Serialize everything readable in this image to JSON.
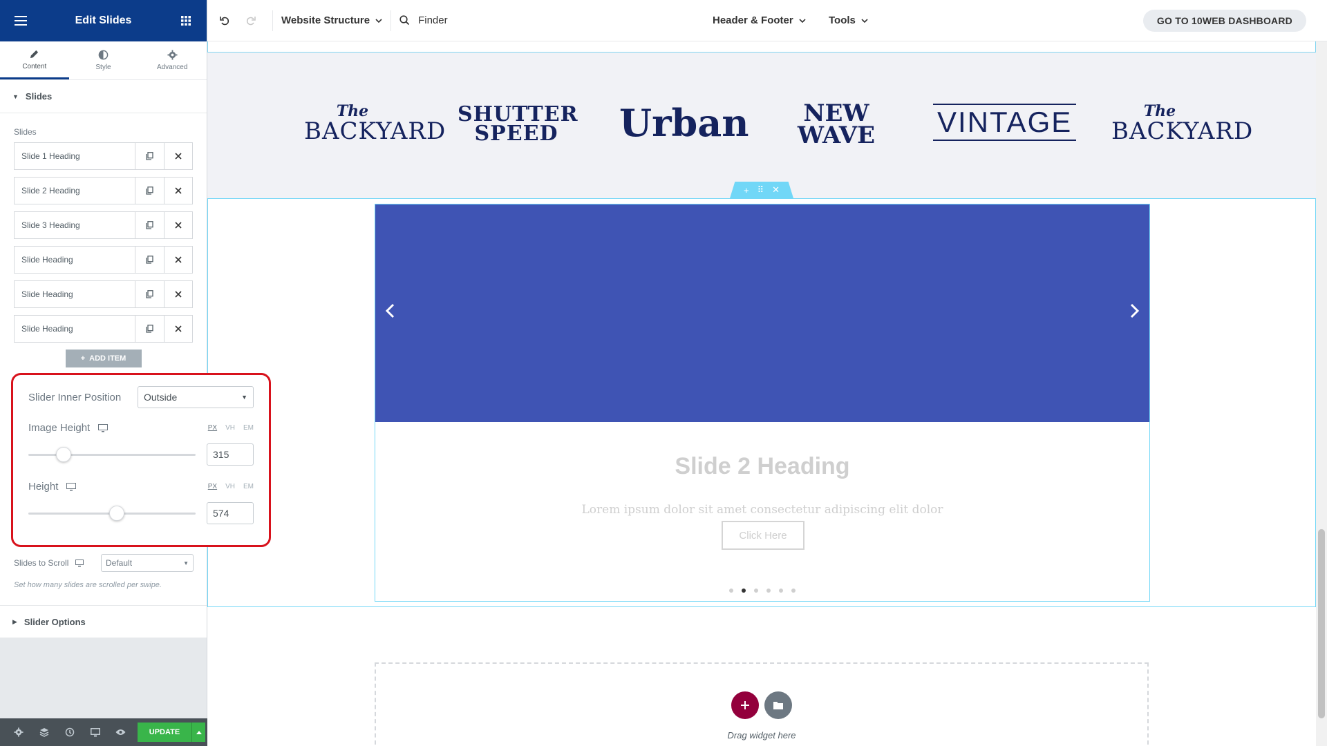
{
  "panel": {
    "title": "Edit Slides",
    "tabs": [
      {
        "label": "Content",
        "icon": "pencil-icon"
      },
      {
        "label": "Style",
        "icon": "half-circle-icon"
      },
      {
        "label": "Advanced",
        "icon": "gear-icon"
      }
    ],
    "section_title": "Slides",
    "slides_label": "Slides",
    "slides": [
      {
        "title": "Slide 1 Heading"
      },
      {
        "title": "Slide 2 Heading"
      },
      {
        "title": "Slide 3 Heading"
      },
      {
        "title": "Slide Heading"
      },
      {
        "title": "Slide Heading"
      },
      {
        "title": "Slide Heading"
      }
    ],
    "add_item_label": "ADD ITEM",
    "inner_position": {
      "label": "Slider Inner Position",
      "value": "Outside"
    },
    "image_height": {
      "label": "Image Height",
      "value": "315",
      "units": [
        "PX",
        "VH",
        "EM"
      ],
      "active_unit": "PX",
      "fraction": 0.18
    },
    "height": {
      "label": "Height",
      "value": "574",
      "units": [
        "PX",
        "VH",
        "EM"
      ],
      "active_unit": "PX",
      "fraction": 0.53
    },
    "slides_to_scroll": {
      "label": "Slides to Scroll",
      "value": "Default",
      "help": "Set how many slides are scrolled per swipe."
    },
    "slider_options_title": "Slider Options",
    "footer": {
      "update_label": "UPDATE"
    }
  },
  "topbar": {
    "website_structure": "Website Structure",
    "finder": "Finder",
    "header_footer": "Header & Footer",
    "tools": "Tools",
    "dashboard_button": "GO TO 10WEB DASHBOARD"
  },
  "logos": [
    {
      "small": "The",
      "big": "BACKYARD"
    },
    {
      "line1": "SHUTTER",
      "line2": "SPEED"
    },
    {
      "text": "Urban"
    },
    {
      "line1": "NEW",
      "line2": "WAVE"
    },
    {
      "text": "VINTAGE"
    },
    {
      "small": "The",
      "big": "BACKYARD"
    }
  ],
  "slide": {
    "heading": "Slide 2 Heading",
    "description": "Lorem ipsum dolor sit amet consectetur adipiscing elit dolor",
    "button": "Click Here",
    "dot_count": 6,
    "active_dot": 1,
    "image_color": "#3f54b4"
  },
  "drop_zone": {
    "text": "Drag widget here"
  },
  "colors": {
    "brand": "#0c3c8a",
    "highlight": "#d8121c",
    "update": "#39b54a",
    "accent_cyan": "#71d7f7",
    "add_button": "#93003c"
  }
}
